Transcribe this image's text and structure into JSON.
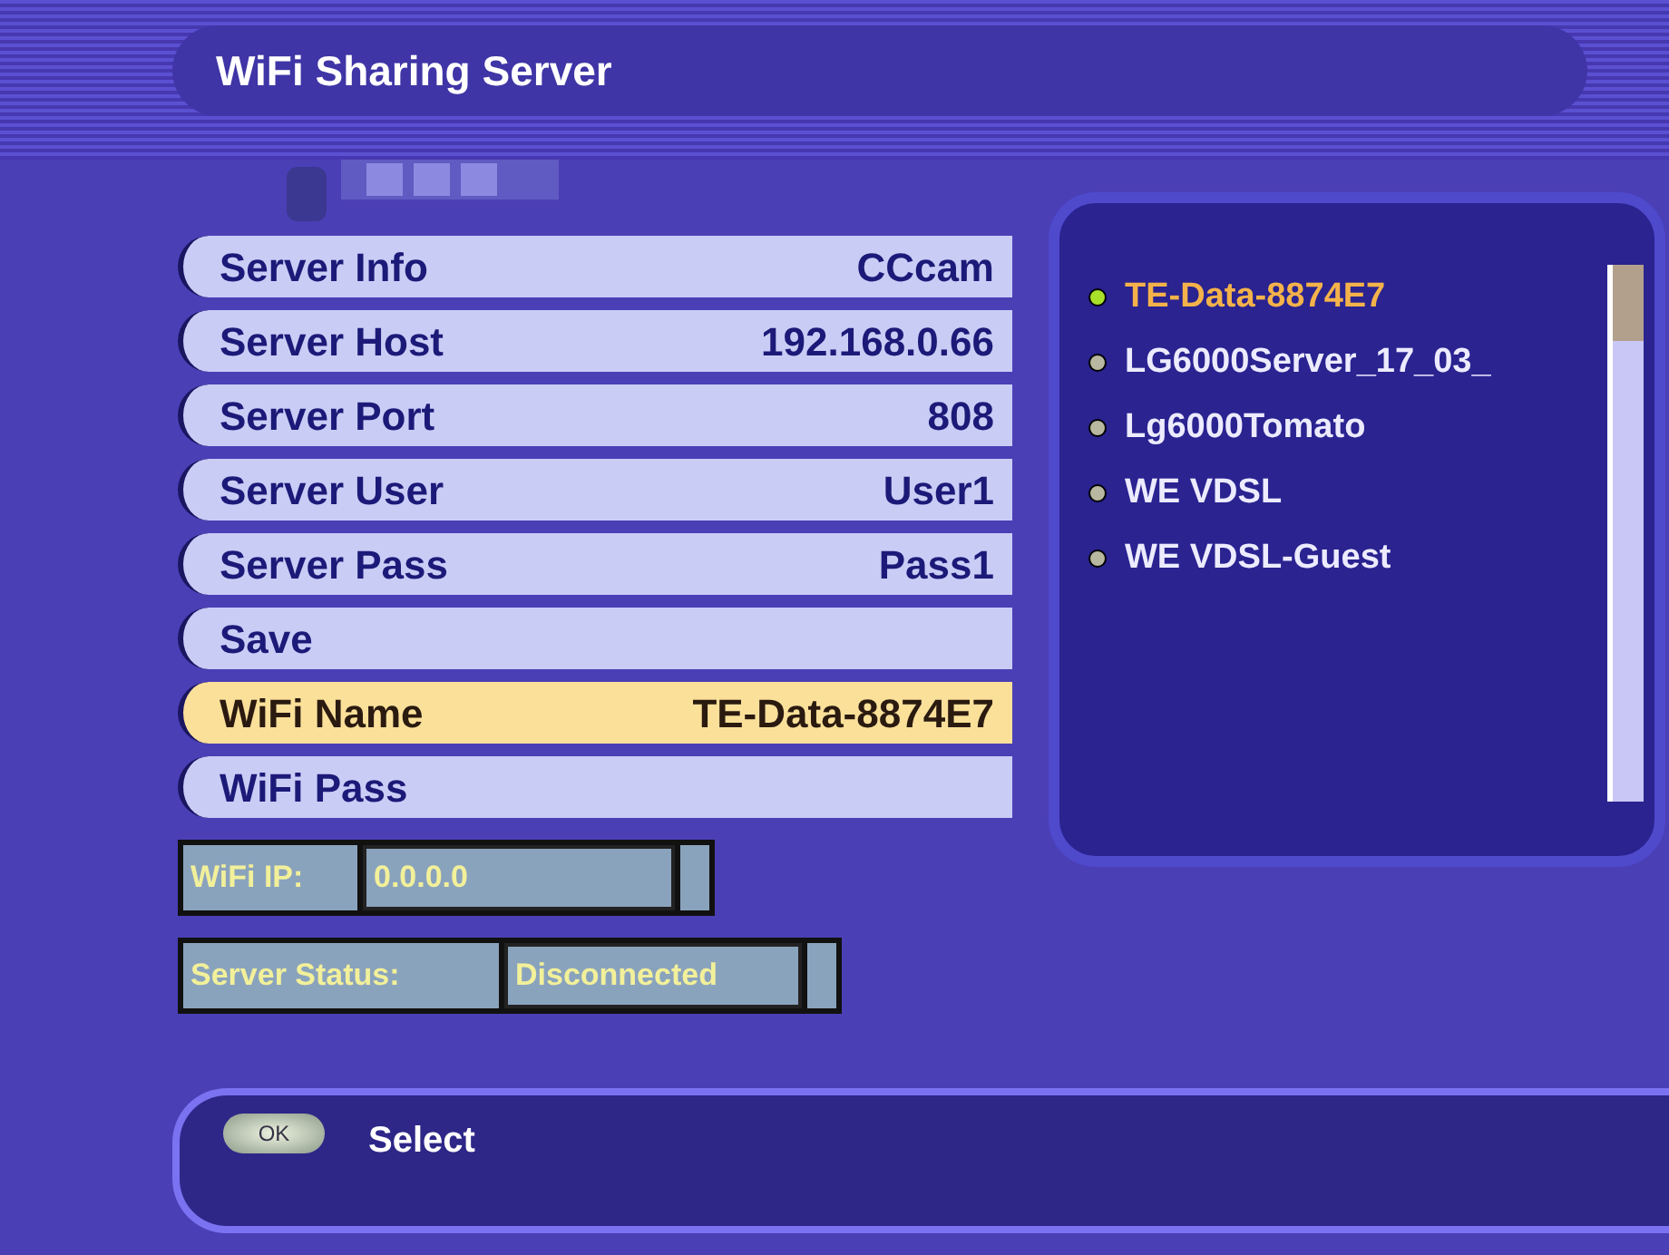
{
  "title": "WiFi Sharing Server",
  "menu": [
    {
      "label": "Server Info",
      "value": "CCcam",
      "selected": false
    },
    {
      "label": "Server Host",
      "value": "192.168.0.66",
      "selected": false
    },
    {
      "label": "Server Port",
      "value": "808",
      "selected": false
    },
    {
      "label": "Server User",
      "value": "User1",
      "selected": false
    },
    {
      "label": "Server Pass",
      "value": "Pass1",
      "selected": false
    },
    {
      "label": "Save",
      "selected": false
    },
    {
      "label": "WiFi Name",
      "value": "TE-Data-8874E7",
      "selected": true
    },
    {
      "label": "WiFi Pass",
      "selected": false
    }
  ],
  "status_fields": [
    {
      "label": "WiFi IP:",
      "value": "0.0.0.0"
    },
    {
      "label": "Server Status:",
      "value": "Disconnected"
    }
  ],
  "networks": [
    {
      "name": "TE-Data-8874E7",
      "selected": true
    },
    {
      "name": "LG6000Server_17_03_",
      "selected": false
    },
    {
      "name": "Lg6000Tomato",
      "selected": false
    },
    {
      "name": "WE VDSL",
      "selected": false
    },
    {
      "name": "WE VDSL-Guest",
      "selected": false
    }
  ],
  "help": {
    "key": "OK",
    "action": "Select"
  }
}
